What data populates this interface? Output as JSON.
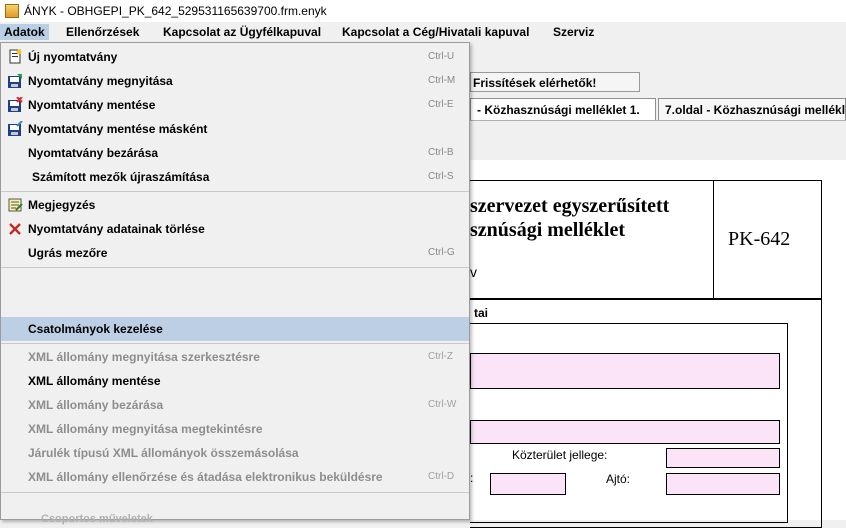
{
  "window": {
    "title": "ÁNYK - OBHGEPI_PK_642_529531165639700.frm.enyk"
  },
  "menubar": [
    "Adatok",
    "Ellenőrzések",
    "Kapcsolat az Ügyfélkapuval",
    "Kapcsolat a Cég/Hivatali kapuval",
    "Szerviz"
  ],
  "notice": "Frissítések elérhetők!",
  "tabs": [
    "- Közhasznúsági melléklet 1.",
    "7.oldal - Közhasznúsági mellékle"
  ],
  "document": {
    "heading_line1": "szervezet egyszerűsített",
    "heading_line2": "sznúsági melléklet",
    "form_code": "PK-642",
    "version_mark": "v",
    "section_title": "tai",
    "label_kozterulet": "Közterület jellege:",
    "label_ajto": "Ajtó:",
    "label_colon": ":"
  },
  "dropdown": {
    "items": [
      {
        "label": "Új nyomtatvány",
        "shortcut": "Ctrl-U",
        "icon": "new-form-icon",
        "enabled": true
      },
      {
        "label": "Nyomtatvány megnyitása",
        "shortcut": "Ctrl-M",
        "icon": "open-form-icon",
        "enabled": true
      },
      {
        "label": "Nyomtatvány mentése",
        "shortcut": "Ctrl-E",
        "icon": "save-form-icon",
        "enabled": true
      },
      {
        "label": "Nyomtatvány mentése másként",
        "shortcut": "",
        "icon": "save-as-icon",
        "enabled": true
      },
      {
        "label": "Nyomtatvány bezárása",
        "shortcut": "Ctrl-B",
        "icon": "",
        "enabled": true
      },
      {
        "label": "Számított mezők újraszámítása",
        "shortcut": "Ctrl-S",
        "icon": "",
        "enabled": true
      },
      {
        "label": "Megjegyzés",
        "shortcut": "",
        "icon": "note-icon",
        "enabled": true
      },
      {
        "label": "Nyomtatvány adatainak törlése",
        "shortcut": "",
        "icon": "delete-icon",
        "enabled": true
      },
      {
        "label": "Ugrás mezőre",
        "shortcut": "Ctrl-G",
        "icon": "",
        "enabled": true
      },
      {
        "label": "Csatolmányok kezelése",
        "shortcut": "",
        "icon": "",
        "enabled": true
      },
      {
        "label": "XML állomány megnyitása szerkesztésre",
        "shortcut": "Ctrl-Z",
        "icon": "",
        "enabled": false
      },
      {
        "label": "XML állomány mentése",
        "shortcut": "",
        "icon": "",
        "enabled": true
      },
      {
        "label": "XML állomány bezárása",
        "shortcut": "Ctrl-W",
        "icon": "",
        "enabled": false
      },
      {
        "label": "XML állomány megnyitása megtekintésre",
        "shortcut": "",
        "icon": "",
        "enabled": false
      },
      {
        "label": "Járulék típusú XML állományok összemásolása",
        "shortcut": "",
        "icon": "",
        "enabled": false
      },
      {
        "label": "XML állomány ellenőrzése és átadása elektronikus beküldésre",
        "shortcut": "Ctrl-D",
        "icon": "",
        "enabled": false
      }
    ],
    "partial_item": "Csoportos műveletek"
  },
  "colors": {
    "highlight": "#bdcfe4",
    "field_pink": "#fbe3f8"
  }
}
